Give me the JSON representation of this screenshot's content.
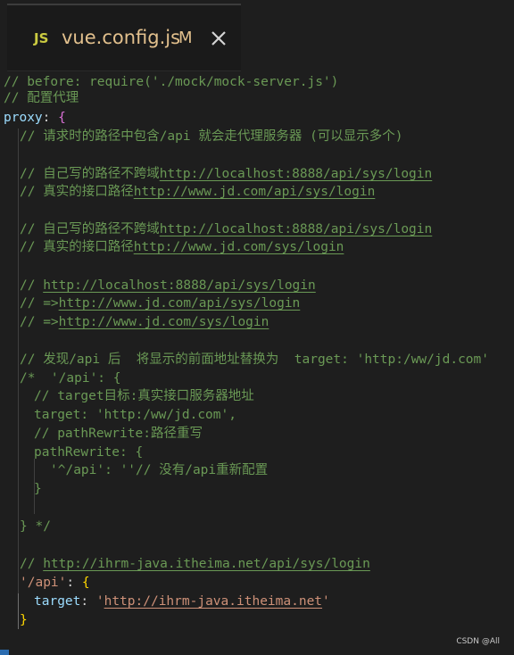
{
  "tab": {
    "icon": "JS",
    "filename": "vue.config.js",
    "status": "M",
    "close_icon": "close-icon"
  },
  "code": {
    "l01": "// before: require('./mock/mock-server.js')",
    "l02": "// 配置代理",
    "l03_key": "proxy",
    "l04": "// 请求时的路径中包含/api 就会走代理服务器 (可以显示多个)",
    "l06_pre": "// 自己写的路径不跨域",
    "l06_url": "http://localhost:8888/api/sys/login",
    "l07_pre": "// 真实的接口路径",
    "l07_url": "http://www.jd.com/api/sys/login",
    "l09_pre": "// 自己写的路径不跨域",
    "l09_url": "http://localhost:8888/api/sys/login",
    "l10_pre": "// 真实的接口路径",
    "l10_url": "http://www.jd.com/sys/login",
    "l12_pre": "// ",
    "l12_url": "http://localhost:8888/api/sys/login",
    "l13_pre": "// =>",
    "l13_url": "http://www.jd.com/api/sys/login",
    "l14_pre": "// =>",
    "l14_url": "http://www.jd.com/sys/login",
    "l16": "// 发现/api 后  将显示的前面地址替换为  target: 'http:/ww/jd.com'",
    "l17": "/*  '/api': {",
    "l18": "// target目标:真实接口服务器地址",
    "l19": "target: 'http:/ww/jd.com',",
    "l20": "// pathRewrite:路径重写",
    "l21": "pathRewrite: {",
    "l22": "'^/api': ''// 没有/api重新配置",
    "l23": "}",
    "l25": "} */",
    "l27_pre": "// ",
    "l27_url": "http://ihrm-java.itheima.net/api/sys/login",
    "l28_key": "'/api'",
    "l29_key": "target",
    "l29_val": "http://ihrm-java.itheima.net",
    "l30": "}"
  },
  "watermark": "CSDN @All"
}
